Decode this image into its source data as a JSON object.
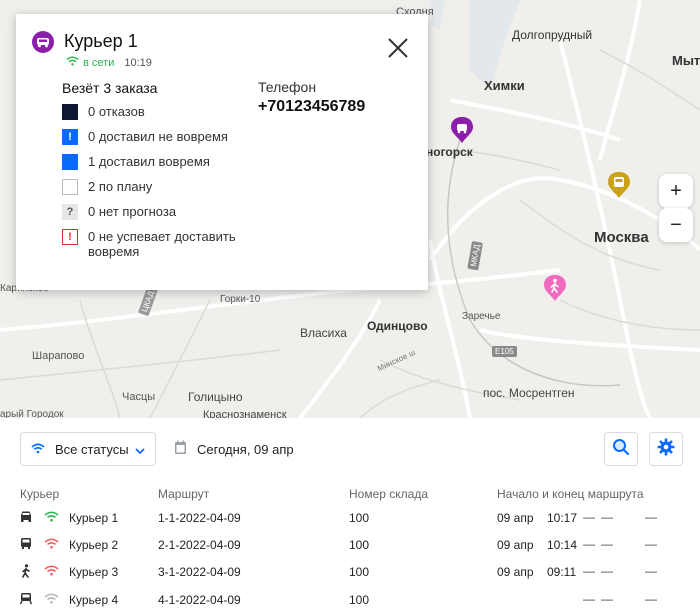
{
  "map": {
    "labels": {
      "skhodnya": "Сходня",
      "dolgoprudny": "Долгопрудный",
      "khimki": "Химки",
      "myt": "Мыт",
      "krasnogorsk": "ногорск",
      "moscow": "Москва",
      "karinskoe": "Каринское",
      "gorki10": "Горки-10",
      "vlasikha": "Власиха",
      "odintsovo": "Одинцово",
      "zarechye": "Заречье",
      "sharapovo": "Шарапово",
      "chasy": "Часцы",
      "golitsyno": "Голицыно",
      "mosrentgen": "пос. Мосрентген",
      "gorodok": "арый Городок",
      "krasnoznamensk": "Краснознаменск"
    },
    "roads": {
      "mkad": "МКАД",
      "cka": "ЦКАД",
      "minskoe": "Минское ш",
      "e105": "E105"
    },
    "zoom_in": "+",
    "zoom_out": "−"
  },
  "popup": {
    "title": "Курьер 1",
    "status": "в сети",
    "status_time": "10:19",
    "carry": "Везёт 3 заказа",
    "legend": [
      {
        "label": "0 отказов",
        "kind": "dark"
      },
      {
        "label": "0 доставил не вовремя",
        "kind": "blue-excl"
      },
      {
        "label": "1 доставил вовремя",
        "kind": "blue"
      },
      {
        "label": "2 по плану",
        "kind": "empty"
      },
      {
        "label": "0 нет прогноза",
        "kind": "grey-q"
      },
      {
        "label": "0 не успевает доставить вовремя",
        "kind": "red-excl"
      }
    ],
    "phone_label": "Телефон",
    "phone_value": "+70123456789"
  },
  "toolbar": {
    "status_filter": "Все статусы",
    "date": "Сегодня, 09 апр"
  },
  "table": {
    "headers": {
      "courier": "Курьер",
      "route": "Маршрут",
      "warehouse": "Номер склада",
      "start_end": "Начало и конец маршрута"
    },
    "rows": [
      {
        "icon": "car",
        "signal": "green",
        "name": "Курьер 1",
        "route": "1-1-2022-04-09",
        "warehouse": "100",
        "date": "09 апр",
        "time": "10:17",
        "d1": "—",
        "d2": "—",
        "d3": "—"
      },
      {
        "icon": "bus",
        "signal": "red",
        "name": "Курьер 2",
        "route": "2-1-2022-04-09",
        "warehouse": "100",
        "date": "09 апр",
        "time": "10:14",
        "d1": "—",
        "d2": "—",
        "d3": "—"
      },
      {
        "icon": "walk",
        "signal": "red",
        "name": "Курьер 3",
        "route": "3-1-2022-04-09",
        "warehouse": "100",
        "date": "09 апр",
        "time": "09:11",
        "d1": "—",
        "d2": "—",
        "d3": "—"
      },
      {
        "icon": "tram",
        "signal": "grey",
        "name": "Курьер 4",
        "route": "4-1-2022-04-09",
        "warehouse": "100",
        "date": "",
        "time": "",
        "d1": "—",
        "d2": "—",
        "d3": "—"
      }
    ]
  },
  "colors": {
    "accent_blue": "#0a6cff",
    "signal_green": "#2bb34b",
    "signal_red": "#f05a5a",
    "signal_grey": "#b5b5b5",
    "courier_purple": "#8b1fa9",
    "courier_gold": "#c9a216",
    "courier_pink": "#f06bbf"
  }
}
